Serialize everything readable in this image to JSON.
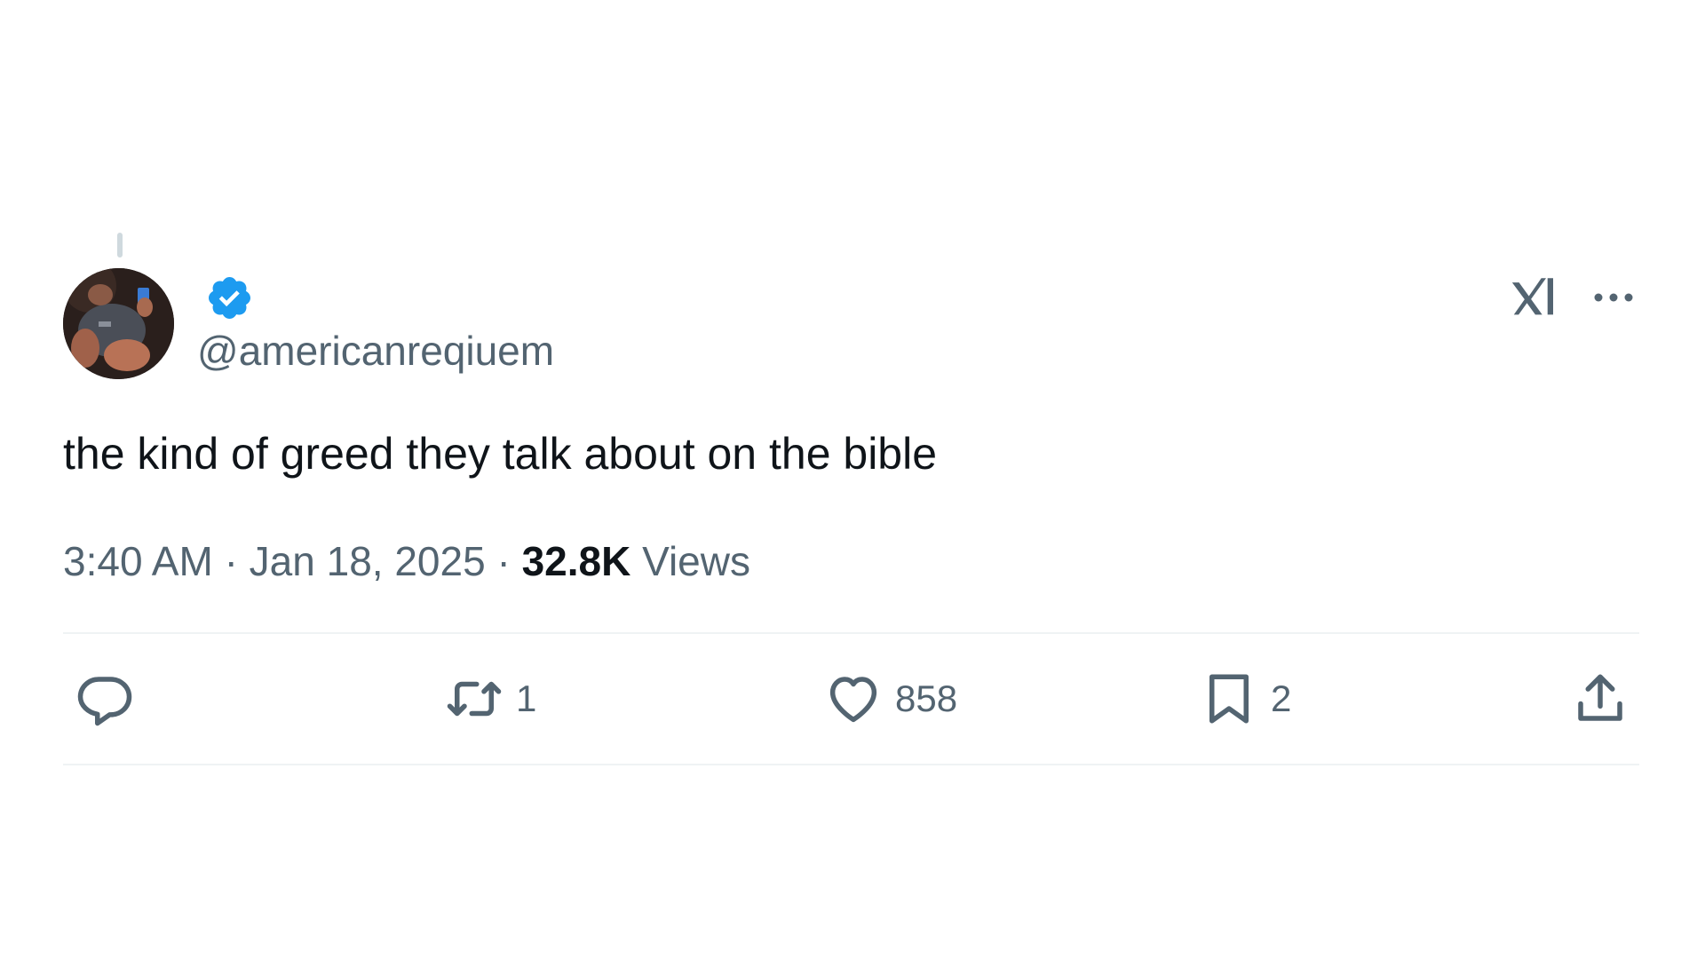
{
  "tweet": {
    "handle": "@americanreqiuem",
    "verified": true,
    "text": "the kind of greed they talk about on the bible",
    "timestamp": "3:40 AM",
    "date": "Jan 18, 2025",
    "separator": "·",
    "views_count": "32.8K",
    "views_label": "Views"
  },
  "actions": {
    "reply": {
      "icon": "reply-icon",
      "count": ""
    },
    "retweet": {
      "icon": "retweet-icon",
      "count": "1"
    },
    "like": {
      "icon": "heart-icon",
      "count": "858"
    },
    "bookmark": {
      "icon": "bookmark-icon",
      "count": "2"
    },
    "share": {
      "icon": "share-icon",
      "count": ""
    }
  },
  "icons": {
    "verified": "verified-badge-icon",
    "brand": "x-logo-icon",
    "more": "more-icon"
  },
  "colors": {
    "text": "#0f1419",
    "secondary": "#536471",
    "verified": "#1d9bf0",
    "divider": "#eff3f4"
  }
}
